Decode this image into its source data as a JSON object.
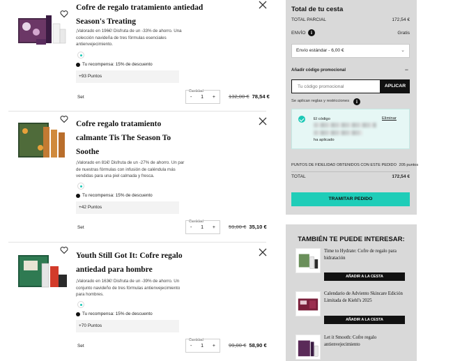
{
  "cart": {
    "items": [
      {
        "title": "Cofre de regalo tratamiento antiedad Season's Treating",
        "desc": "¡Valorado en 196€! Disfruta de un -33% de ahorro. Una colección navideña de tres fórmulas esenciales antienvejecimiento.",
        "reward": "Tu recompensa: 15% de descuento",
        "points": "+93 Puntos",
        "type": "Set",
        "qty_label": "Cantidad",
        "qty": "1",
        "old_price": "132,00 €",
        "new_price": "78,54 €"
      },
      {
        "title": "Cofre regalo tratamiento calmante Tis The Season To Soothe",
        "desc": "¡Valorado en 81€! Disfruta de un -27% de ahorro. Un par de nuestras fórmulas con infusión de caléndula más vendidas para una piel calmada y fresca.",
        "reward": "Tu recompensa: 15% de descuento",
        "points": "+42 Puntos",
        "type": "Set",
        "qty_label": "Cantidad",
        "qty": "1",
        "old_price": "59,00 €",
        "new_price": "35,10 €"
      },
      {
        "title": "Youth Still Got It: Cofre regalo antiedad para hombre",
        "desc": "¡Valorado en 163€! Disfruta de un -39% de ahorro. Un conjunto navideño de tres fórmulas antienvejecimiento para hombres.",
        "reward": "Tu recompensa: 15% de descuento",
        "points": "+70 Puntos",
        "type": "Set",
        "qty_label": "Cantidad",
        "qty": "1",
        "old_price": "99,00 €",
        "new_price": "58,90 €"
      }
    ]
  },
  "summary": {
    "title": "Total de tu cesta",
    "subtotal_label": "TOTAL PARCIAL",
    "subtotal_value": "172,54 €",
    "shipping_label": "ENVÍO",
    "shipping_value": "Gratis",
    "shipping_select": "Envío estándar - 6,00 €",
    "promo_heading": "Añadir código promocional",
    "promo_toggle": "−",
    "promo_placeholder": "Tu código promocional",
    "apply_label": "APLICAR",
    "rules_text": "Se aplican reglas y restricciones",
    "code_label": "El código",
    "remove_label": "Eliminar",
    "applied_text": "ha aplicado",
    "loyalty_label": "PUNTOS DE FIDELIDAD OBTENIDOS CON ESTE PEDIDO",
    "loyalty_value": "205 puntos",
    "total_label": "TOTAL",
    "total_value": "172,54 €",
    "checkout_label": "TRAMITAR PEDIDO"
  },
  "recs": {
    "title": "TAMBIÉN TE PUEDE INTERESAR:",
    "items": [
      {
        "name": "Time to Hydrate: Cofre de regalo para hidratación",
        "button": "AÑADIR A LA CESTA"
      },
      {
        "name": "Calendario de Adviento Skincare Edición Limitada de Kiehl's 2025",
        "button": "AÑADIR A LA CESTA"
      },
      {
        "name": "Let it Smooth: Cofre regalo antienvejecimiento",
        "button": ""
      }
    ]
  },
  "colors": {
    "accent": "#1fcdb8",
    "panel": "#d9d9d9",
    "dark": "#111111"
  }
}
